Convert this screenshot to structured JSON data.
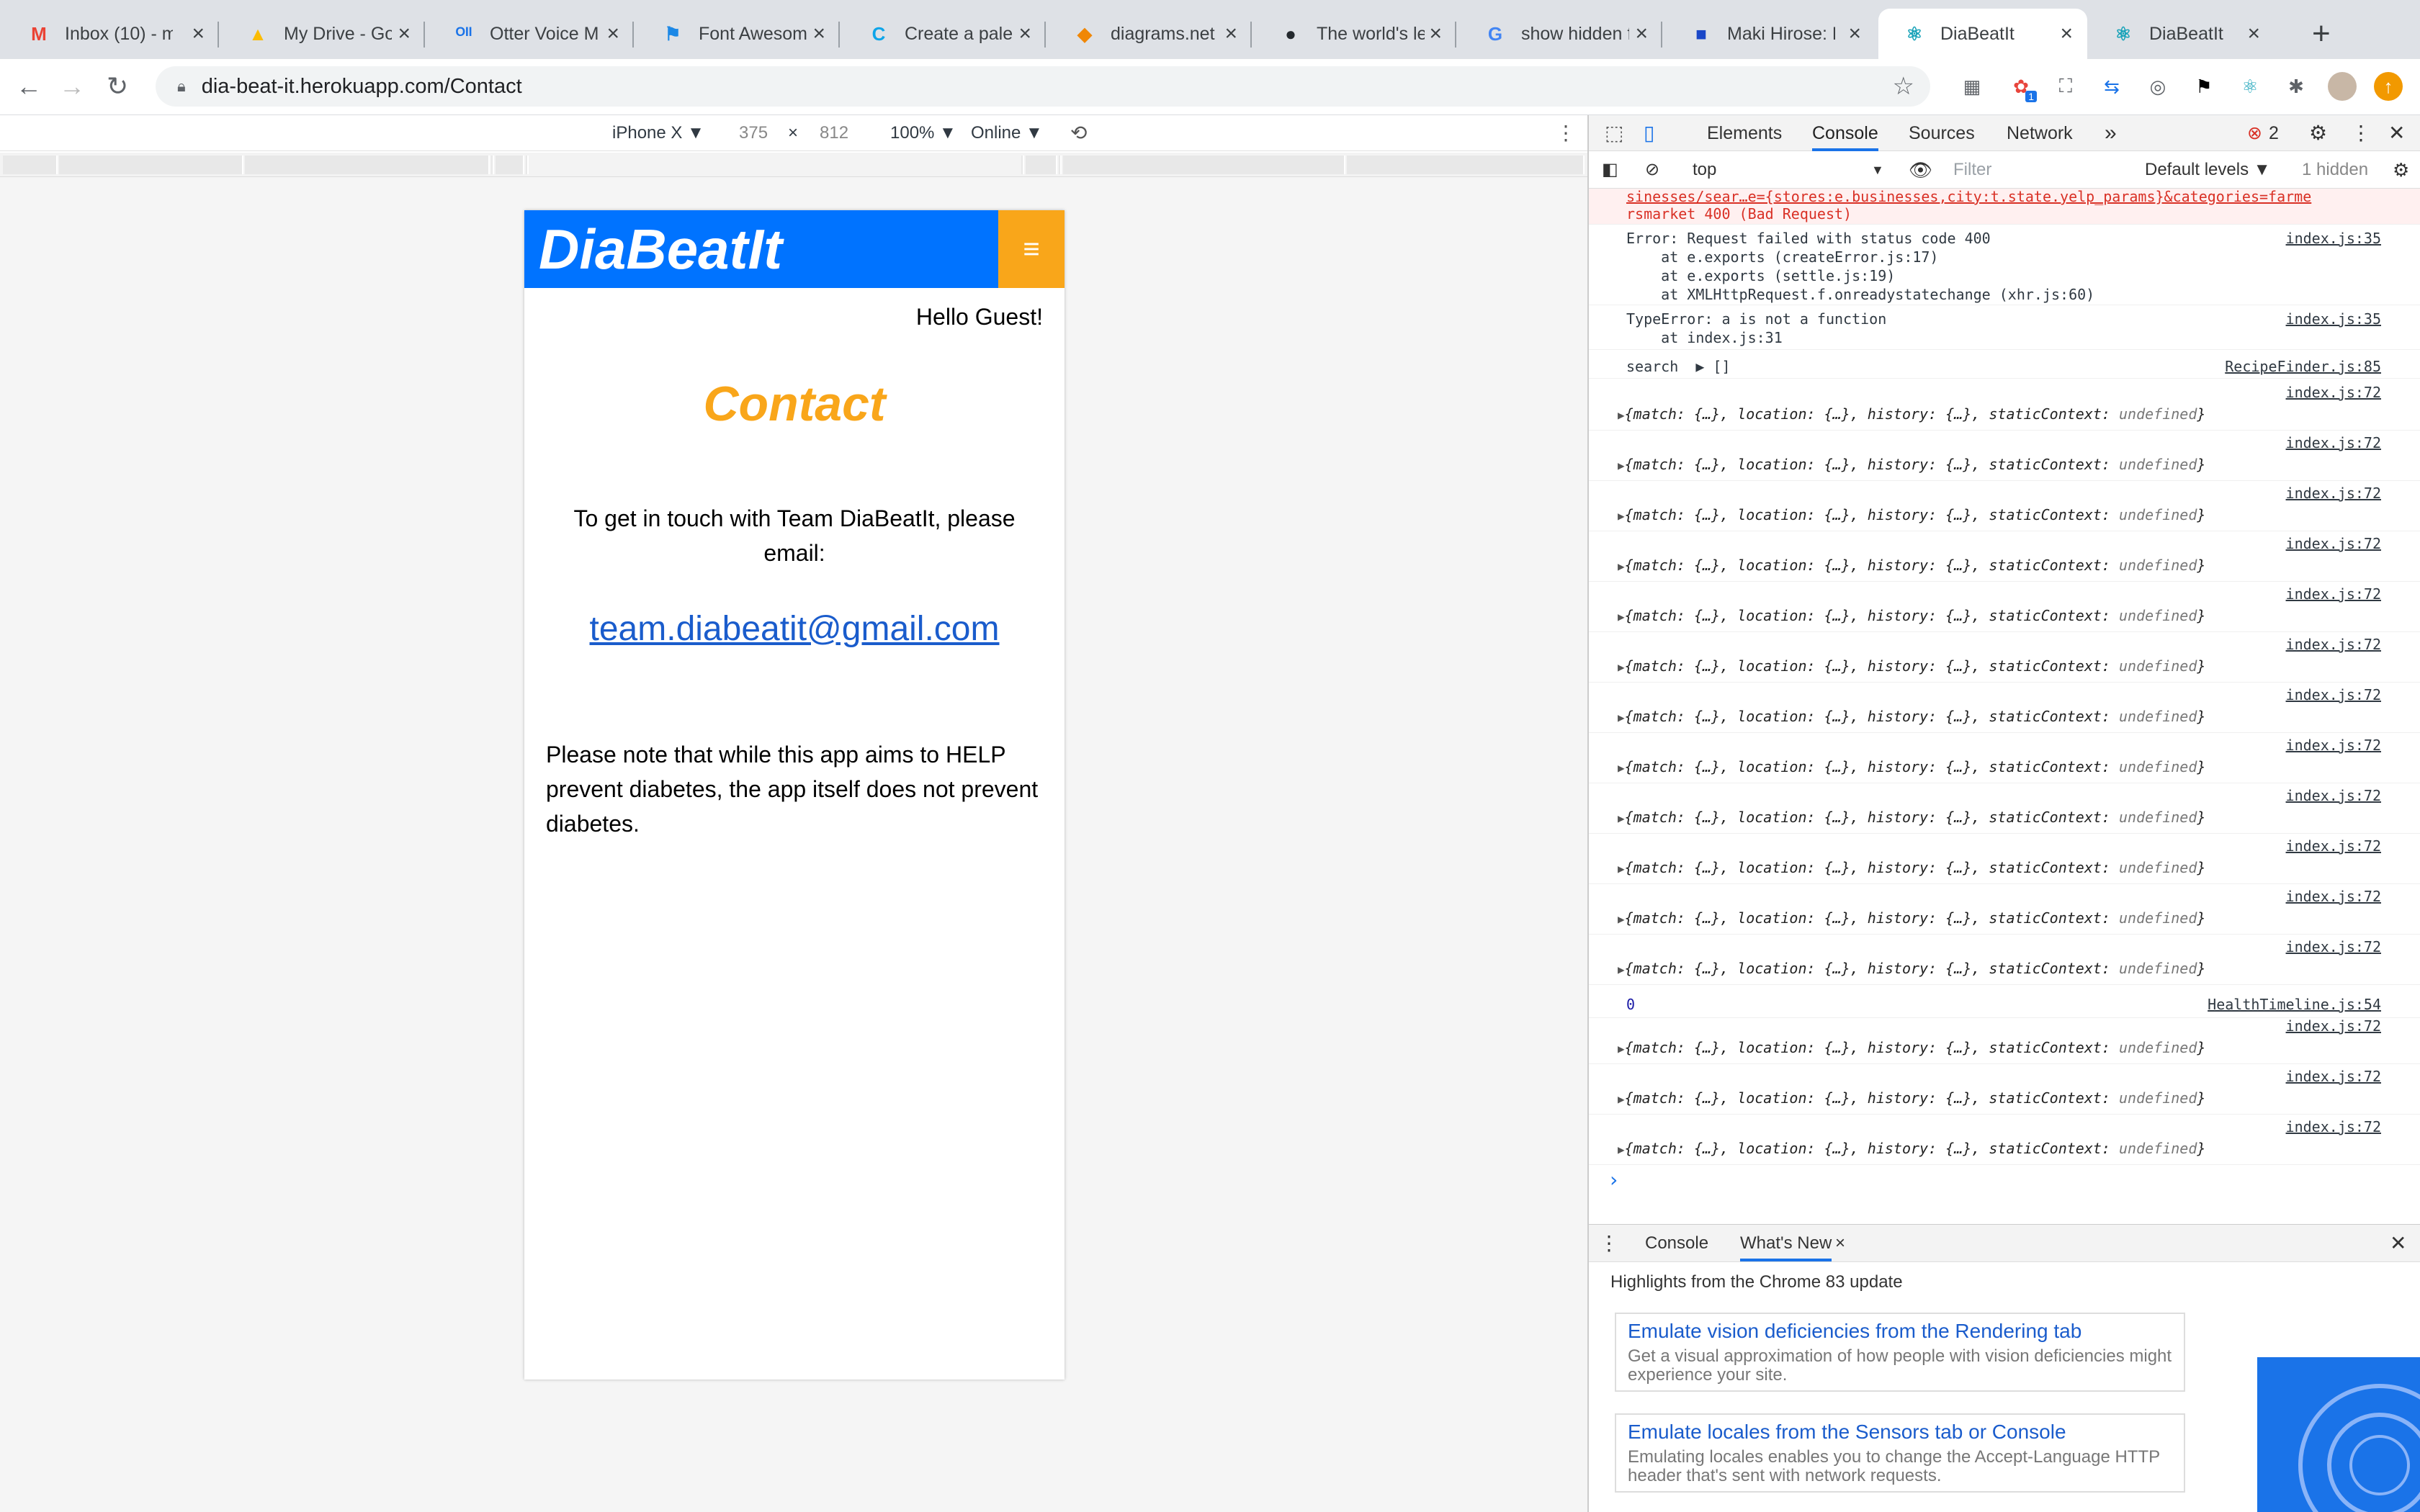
{
  "tabs": [
    {
      "title": "Inbox (10) - m",
      "icon": "gmail-icon",
      "icon_glyph": "M",
      "icon_color": "#ea4335"
    },
    {
      "title": "My Drive - Go",
      "icon": "google-drive-icon",
      "icon_glyph": "▲",
      "icon_color": "#fbbc04"
    },
    {
      "title": "Otter Voice M",
      "icon": "otter-icon",
      "icon_glyph": "ᴼᴵᴵ",
      "icon_color": "#1a73e8"
    },
    {
      "title": "Font Awesom",
      "icon": "font-awesome-flag-icon",
      "icon_glyph": "⚑",
      "icon_color": "#1c88e6"
    },
    {
      "title": "Create a palet",
      "icon": "coolors-icon",
      "icon_glyph": "C",
      "icon_color": "#0ea5e9"
    },
    {
      "title": "diagrams.net",
      "icon": "diagrams-net-icon",
      "icon_glyph": "◆",
      "icon_color": "#f08705"
    },
    {
      "title": "The world's le",
      "icon": "github-icon",
      "icon_glyph": "●",
      "icon_color": "#24292e"
    },
    {
      "title": "show hidden f",
      "icon": "google-icon",
      "icon_glyph": "G",
      "icon_color": "#4285f4"
    },
    {
      "title": "Maki Hirose: L",
      "icon": "bookmark-square-icon",
      "icon_glyph": "■",
      "icon_color": "#1a47c8"
    },
    {
      "title": "DiaBeatIt",
      "icon": "react-icon",
      "icon_glyph": "⚛",
      "icon_color": "#17a2b8"
    },
    {
      "title": "DiaBeatIt",
      "icon": "react-icon",
      "icon_glyph": "⚛",
      "icon_color": "#17a2b8"
    }
  ],
  "address": {
    "url": "dia-beat-it.herokuapp.com/Contact"
  },
  "extensions": {
    "badge_count": "1"
  },
  "device_toolbar": {
    "device": "iPhone X ▼",
    "width": "375",
    "times": "×",
    "height": "812",
    "zoom": "100% ▼",
    "network": "Online ▼"
  },
  "app": {
    "brand": "DiaBeatIt",
    "menu_icon": "≡",
    "greeting": "Hello Guest!",
    "title": "Contact",
    "intro": "To get in touch with Team DiaBeatIt, please email:",
    "email": "team.diabeatit@gmail.com",
    "note": "Please note that while this app aims to HELP prevent diabetes, the app itself does not prevent diabetes.",
    "brand_color": "#0073ff",
    "accent_color": "#f9a61a"
  },
  "devtools": {
    "tabs": [
      "Elements",
      "Console",
      "Sources",
      "Network"
    ],
    "more": "»",
    "error_count": "2",
    "context": "top",
    "filter_placeholder": "Filter",
    "levels": "Default levels ▼",
    "hidden": "1 hidden",
    "console": {
      "error_line1": "sinesses/sear…e={stores:e.businesses,city:t.state.yelp_params}&categories=farme",
      "error_line2": "rsmarket 400 (Bad Request)",
      "err400": [
        "Error: Request failed with status code 400",
        "    at e.exports (createError.js:17)",
        "    at e.exports (settle.js:19)",
        "    at XMLHttpRequest.f.onreadystatechange (xhr.js:60)"
      ],
      "err400_src": "index.js:35",
      "type_error": [
        "TypeError: a is not a function",
        "    at index.js:31"
      ],
      "type_error_src": "index.js:35",
      "search_msg": "search  ▶ []",
      "search_src": "RecipeFinder.js:85",
      "object_msg_a": "{match: {…}, location: {…}, history: {…}, staticContext: ",
      "object_msg_b": "undefined",
      "object_msg_c": "}",
      "object_src": "index.js:72",
      "zero_value": "0",
      "zero_src": "HealthTimeline.js:54",
      "prompt": "›"
    },
    "drawer": {
      "tabs": [
        "Console",
        "What's New"
      ],
      "highlights": "Highlights from the Chrome 83 update",
      "cards": [
        {
          "title": "Emulate vision deficiencies from the Rendering tab",
          "desc": "Get a visual approximation of how people with vision deficiencies might experience your site."
        },
        {
          "title": "Emulate locales from the Sensors tab or Console",
          "desc": "Emulating locales enables you to change the Accept-Language HTTP header that's sent with network requests."
        }
      ]
    }
  }
}
